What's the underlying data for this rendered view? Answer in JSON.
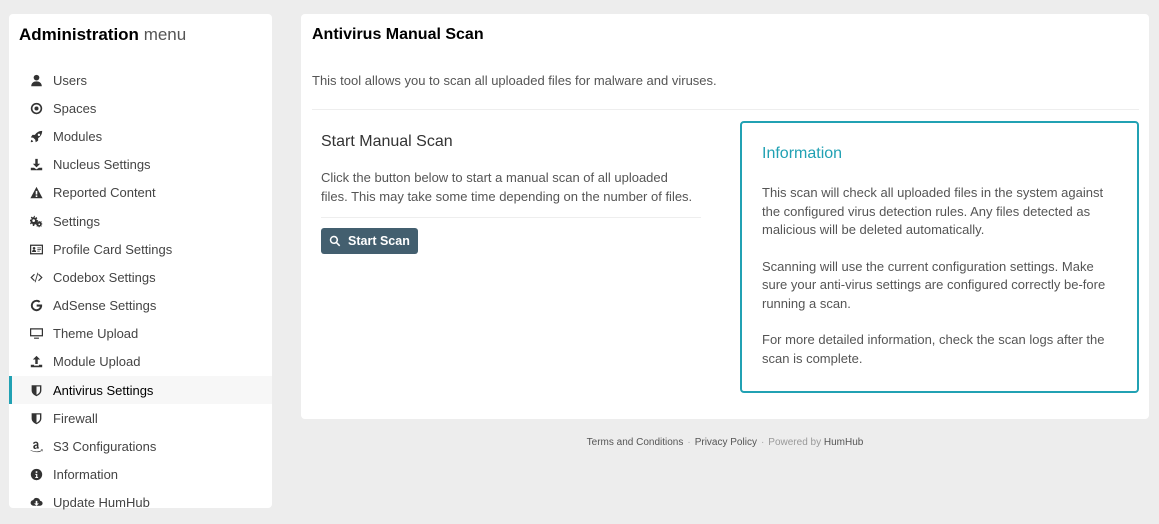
{
  "sidebar": {
    "title_bold": "Administration",
    "title_light": "menu",
    "items": [
      {
        "label": "Users",
        "icon": "user-icon"
      },
      {
        "label": "Spaces",
        "icon": "dot-circle-icon"
      },
      {
        "label": "Modules",
        "icon": "rocket-icon"
      },
      {
        "label": "Nucleus Settings",
        "icon": "download-icon"
      },
      {
        "label": "Reported Content",
        "icon": "warning-icon"
      },
      {
        "label": "Settings",
        "icon": "gears-icon"
      },
      {
        "label": "Profile Card Settings",
        "icon": "id-card-icon"
      },
      {
        "label": "Codebox Settings",
        "icon": "code-icon"
      },
      {
        "label": "AdSense Settings",
        "icon": "google-icon"
      },
      {
        "label": "Theme Upload",
        "icon": "desktop-icon"
      },
      {
        "label": "Module Upload",
        "icon": "upload-icon"
      },
      {
        "label": "Antivirus Settings",
        "icon": "shield-icon",
        "active": true
      },
      {
        "label": "Firewall",
        "icon": "shield-icon"
      },
      {
        "label": "S3 Configurations",
        "icon": "amazon-icon"
      },
      {
        "label": "Information",
        "icon": "info-circle-icon"
      },
      {
        "label": "Update HumHub",
        "icon": "cloud-download-icon"
      }
    ]
  },
  "main": {
    "title": "Antivirus Manual Scan",
    "description": "This tool allows you to scan all uploaded files for malware and viruses.",
    "scan": {
      "title": "Start Manual Scan",
      "text": "Click the button below to start a manual scan of all uploaded files. This may take some time depending on the number of files.",
      "button_label": "Start Scan"
    },
    "info": {
      "title": "Information",
      "p1": "This scan will check all uploaded files in the system against the configured virus detection rules. Any files detected as malicious will be deleted automatically.",
      "p2": "Scanning will use the current configuration settings. Make sure your anti-virus settings are configured correctly be-fore running a scan.",
      "p3": "For more detailed information, check the scan logs after the scan is complete."
    }
  },
  "footer": {
    "terms": "Terms and Conditions",
    "privacy": "Privacy Policy",
    "powered_prefix": "Powered by",
    "powered_name": "HumHub"
  },
  "colors": {
    "accent": "#21a1b3",
    "button": "#435f6f",
    "background": "#ededed"
  }
}
